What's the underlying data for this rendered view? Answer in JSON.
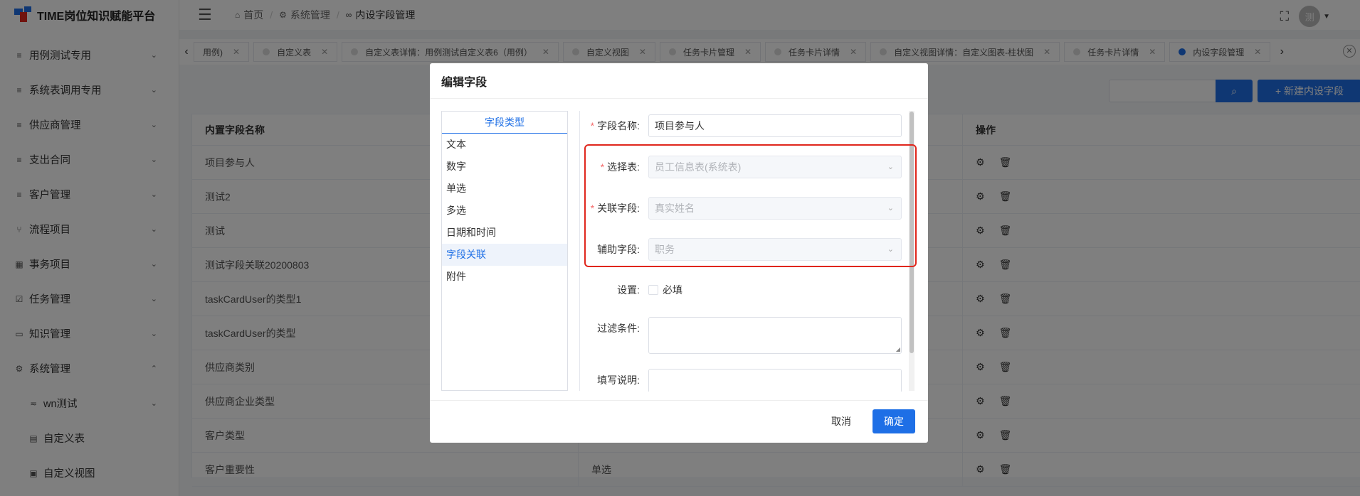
{
  "app": {
    "title": "TIME岗位知识赋能平台"
  },
  "sidebar": {
    "items": [
      {
        "label": "用例测试专用",
        "icon": "list-icon"
      },
      {
        "label": "系统表调用专用",
        "icon": "list-icon"
      },
      {
        "label": "供应商管理",
        "icon": "list-icon"
      },
      {
        "label": "支出合同",
        "icon": "list-icon"
      },
      {
        "label": "客户管理",
        "icon": "list-icon"
      },
      {
        "label": "流程项目",
        "icon": "branch-icon"
      },
      {
        "label": "事务项目",
        "icon": "grid-icon"
      },
      {
        "label": "任务管理",
        "icon": "checklist-icon"
      },
      {
        "label": "知识管理",
        "icon": "book-icon"
      },
      {
        "label": "系统管理",
        "icon": "gear-icon"
      }
    ],
    "sub_items": [
      {
        "label": "wn测试",
        "icon": "filter-icon"
      },
      {
        "label": "自定义表",
        "icon": "table-icon"
      },
      {
        "label": "自定义视图",
        "icon": "view-icon"
      }
    ]
  },
  "header": {
    "breadcrumb": [
      "首页",
      "系统管理",
      "内设字段管理"
    ],
    "avatar_text": "测"
  },
  "tabs": [
    {
      "label": "用例)"
    },
    {
      "label": "自定义表"
    },
    {
      "label": "自定义表详情：用例测试自定义表6（用例）"
    },
    {
      "label": "自定义视图"
    },
    {
      "label": "任务卡片管理"
    },
    {
      "label": "任务卡片详情"
    },
    {
      "label": "自定义视图详情：自定义图表-柱状图"
    },
    {
      "label": "任务卡片详情"
    },
    {
      "label": "内设字段管理"
    }
  ],
  "toolbar": {
    "new_label": "+ 新建内设字段"
  },
  "table": {
    "headers": [
      "内置字段名称",
      "",
      "操作"
    ],
    "rows": [
      {
        "name": "项目参与人",
        "type": ""
      },
      {
        "name": "测试2",
        "type": ""
      },
      {
        "name": "测试",
        "type": ""
      },
      {
        "name": "测试字段关联20200803",
        "type": ""
      },
      {
        "name": "taskCardUser的类型1",
        "type": ""
      },
      {
        "name": "taskCardUser的类型",
        "type": ""
      },
      {
        "name": "供应商类别",
        "type": ""
      },
      {
        "name": "供应商企业类型",
        "type": ""
      },
      {
        "name": "客户类型",
        "type": ""
      },
      {
        "name": "客户重要性",
        "type": "单选"
      }
    ]
  },
  "dialog": {
    "title": "编辑字段",
    "type_panel": {
      "header": "字段类型",
      "items": [
        "文本",
        "数字",
        "单选",
        "多选",
        "日期和时间",
        "字段关联",
        "附件"
      ],
      "selected": "字段关联"
    },
    "form": {
      "field_name_label": "字段名称:",
      "field_name_value": "项目参与人",
      "select_table_label": "选择表:",
      "select_table_value": "员工信息表(系统表)",
      "link_field_label": "关联字段:",
      "link_field_value": "真实姓名",
      "aux_field_label": "辅助字段:",
      "aux_field_value": "职务",
      "settings_label": "设置:",
      "required_label": "必填",
      "filter_label": "过滤条件:",
      "desc_label": "填写说明:"
    },
    "cancel_label": "取消",
    "ok_label": "确定"
  },
  "colors": {
    "primary": "#1e6fe6",
    "highlight": "#e0261c",
    "required": "#f56c6c"
  }
}
